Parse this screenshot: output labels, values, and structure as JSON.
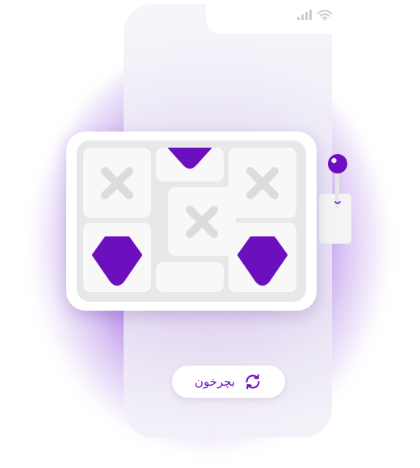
{
  "spin_button": {
    "label": "بچرخون",
    "icon": "refresh-icon"
  },
  "reels": [
    [
      "x-symbol",
      "x-symbol",
      "gem-symbol"
    ],
    [
      "gem-symbol",
      "x-symbol",
      "blank"
    ],
    [
      "x-symbol",
      "gem-symbol"
    ]
  ],
  "colors": {
    "accent": "#6c0fbf",
    "symbol_gray": "#dcdcdc",
    "reel_bg": "#e8e8e8",
    "cell_bg": "#f8f8f8"
  },
  "status_icons": [
    "signal-icon",
    "wifi-icon"
  ]
}
